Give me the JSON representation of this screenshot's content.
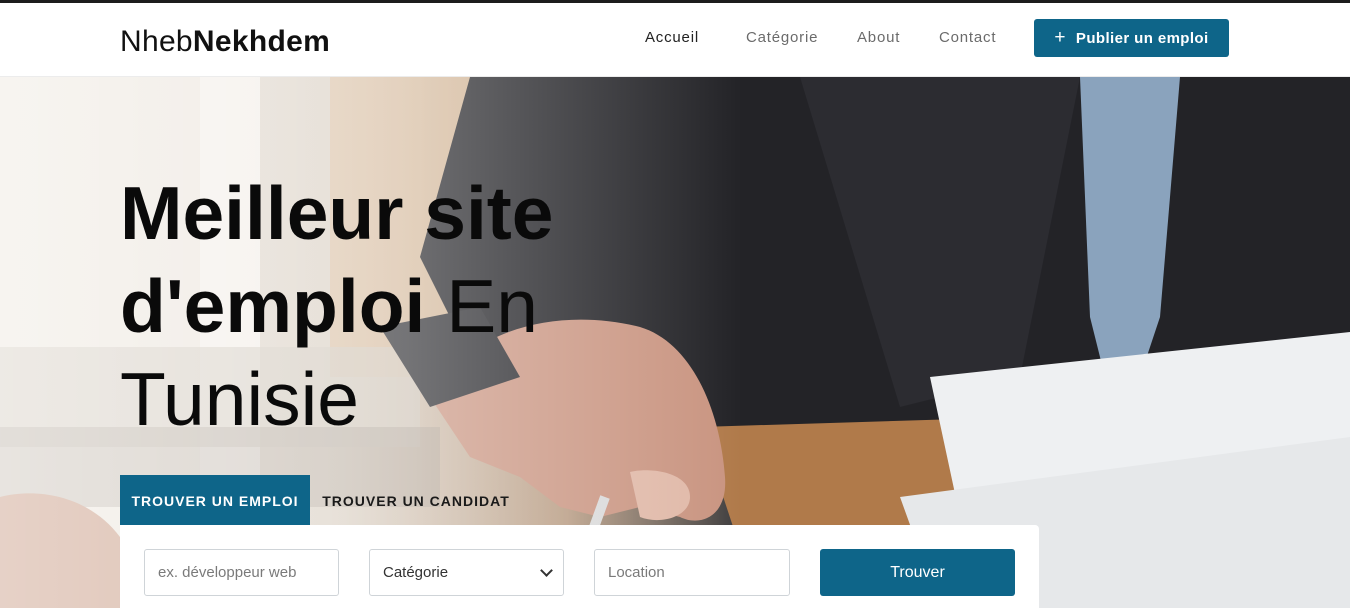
{
  "header": {
    "logo_light": "Nheb",
    "logo_bold": "Nekhdem",
    "nav": {
      "accueil": "Accueil",
      "categorie": "Catégorie",
      "about": "About",
      "contact": "Contact"
    },
    "post_button": "Publier un emploi",
    "post_button_icon": "+"
  },
  "hero": {
    "headline_bold_1": "Meilleur site",
    "headline_bold_2": "d'emploi",
    "headline_light_1": "En",
    "headline_light_2": "Tunisie"
  },
  "tabs": {
    "find_job": "TROUVER UN EMPLOI",
    "find_candidate": "TROUVER UN CANDIDAT"
  },
  "search": {
    "keyword_placeholder": "ex. développeur web",
    "category_selected": "Catégorie",
    "location_placeholder": "Location",
    "submit": "Trouver"
  },
  "colors": {
    "accent": "#0e6589"
  }
}
